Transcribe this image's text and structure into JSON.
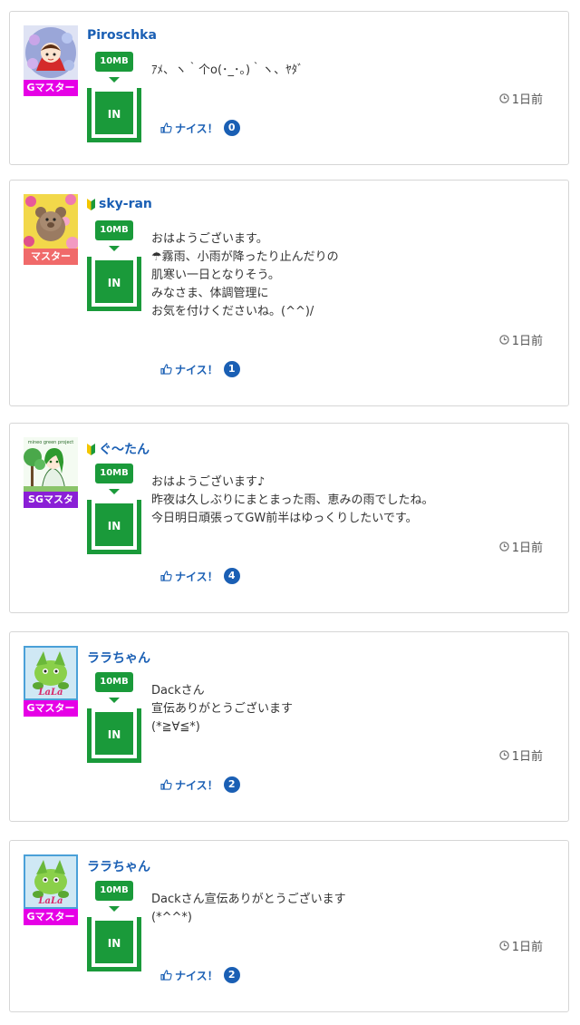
{
  "colors": {
    "link_blue": "#1a5fb4",
    "green": "#1a9a3a",
    "badge_magenta": "#e600e6",
    "badge_salmon": "#f06a6a",
    "badge_purple": "#8a1fd6"
  },
  "posts": [
    {
      "username": "Piroschka",
      "beginner": false,
      "rank": "Gマスター",
      "rank_color": "#e600e6",
      "avatar": "red-hood-girl-avatar",
      "traffic": "10MB",
      "tank_label": "IN",
      "message": "ｱﾒ、ヽ｀个o(･_･｡)｀ヽ、ﾔﾀﾞ",
      "time": "1日前",
      "nice_label": "ナイス！",
      "nice_count": "0"
    },
    {
      "username": "sky-ran",
      "beginner": true,
      "rank": "マスター",
      "rank_color": "#f06a6a",
      "avatar": "plush-bear-flowers-avatar",
      "traffic": "10MB",
      "tank_label": "IN",
      "message": "おはようございます。\n☂霧雨、小雨が降ったり止んだりの\n肌寒い一日となりそう。\nみなさま、体調管理に\nお気を付けくださいね。(^^)/",
      "time": "1日前",
      "nice_label": "ナイス！",
      "nice_count": "1"
    },
    {
      "username": "ぐ～たん",
      "beginner": true,
      "rank": "SGマスタ",
      "rank_color": "#8a1fd6",
      "avatar": "green-project-girl-avatar",
      "avatar_caption": "mineo green project",
      "traffic": "10MB",
      "tank_label": "IN",
      "message": "おはようございます♪\n昨夜は久しぶりにまとまった雨、恵みの雨でしたね。\n今日明日頑張ってGW前半はゆっくりしたいです。",
      "time": "1日前",
      "nice_label": "ナイス！",
      "nice_count": "4"
    },
    {
      "username": "ララちゃん",
      "beginner": false,
      "rank": "Gマスター",
      "rank_color": "#e600e6",
      "avatar": "lala-green-creature-avatar",
      "avatar_caption": "LaLa",
      "traffic": "10MB",
      "tank_label": "IN",
      "message": "Dackさん\n宣伝ありがとうございます\n(*≧∀≦*)",
      "time": "1日前",
      "nice_label": "ナイス！",
      "nice_count": "2"
    },
    {
      "username": "ララちゃん",
      "beginner": false,
      "rank": "Gマスター",
      "rank_color": "#e600e6",
      "avatar": "lala-green-creature-avatar",
      "avatar_caption": "LaLa",
      "traffic": "10MB",
      "tank_label": "IN",
      "message": "Dackさん宣伝ありがとうございます\n(*^^*)",
      "time": "1日前",
      "nice_label": "ナイス！",
      "nice_count": "2"
    }
  ]
}
